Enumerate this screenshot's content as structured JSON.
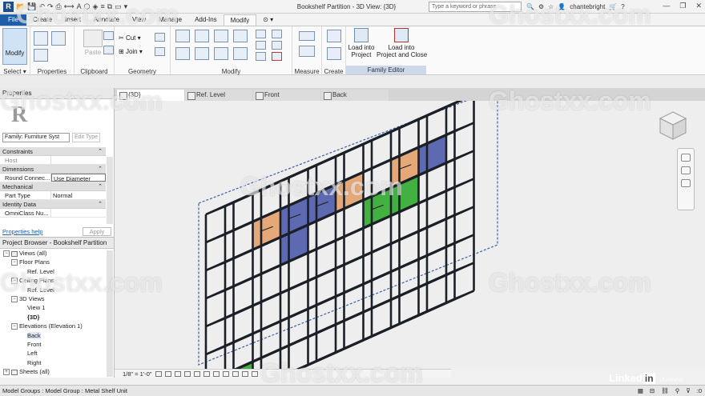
{
  "titlebar": {
    "title": "Bookshelf Partition - 3D View: {3D}",
    "search_placeholder": "Type a keyword or phrase",
    "user": "chantebright"
  },
  "menu": [
    "File",
    "Create",
    "Insert",
    "Annotate",
    "View",
    "Manage",
    "Add-Ins",
    "Modify"
  ],
  "active_menu": "Modify",
  "ribbon": {
    "select": {
      "modify": "Modify",
      "label": "Select ▾"
    },
    "properties_label": "Properties",
    "clipboard": {
      "paste": "Paste",
      "label": "Clipboard"
    },
    "geometry": {
      "cut": "Cut",
      "join": "Join",
      "label": "Geometry"
    },
    "modify_label": "Modify",
    "measure_label": "Measure",
    "create_label": "Create",
    "load_into_project": "Load into\nProject",
    "load_into_project_close": "Load into\nProject and Close",
    "family_editor_label": "Family Editor"
  },
  "view_tabs": [
    "{3D}",
    "Ref. Level",
    "Front",
    "Back"
  ],
  "properties": {
    "header": "Properties",
    "family": "Family: Furniture Syst",
    "edit_type": "Edit Type",
    "rows": [
      {
        "group": "Constraints"
      },
      {
        "key": "Host",
        "value": "",
        "dim": true
      },
      {
        "group": "Dimensions"
      },
      {
        "key": "Round Connec...",
        "value": "Use Diameter",
        "box": true
      },
      {
        "group": "Mechanical"
      },
      {
        "key": "Part Type",
        "value": "Normal"
      },
      {
        "group": "Identity Data"
      },
      {
        "key": "OmniClass Nu...",
        "value": ""
      }
    ],
    "help": "Properties help",
    "apply": "Apply"
  },
  "browser": {
    "header": "Project Browser - Bookshelf Partition",
    "nodes": [
      {
        "text": "Views (all)",
        "indent": 0,
        "toggle": "−",
        "icon": true
      },
      {
        "text": "Floor Plans",
        "indent": 1,
        "toggle": "−"
      },
      {
        "text": "Ref. Level",
        "indent": 3
      },
      {
        "text": "Ceiling Plans",
        "indent": 1,
        "toggle": "−"
      },
      {
        "text": "Ref. Level",
        "indent": 3
      },
      {
        "text": "3D Views",
        "indent": 1,
        "toggle": "−"
      },
      {
        "text": "View 1",
        "indent": 3
      },
      {
        "text": "{3D}",
        "indent": 3,
        "bold": true
      },
      {
        "text": "Elevations (Elevation 1)",
        "indent": 1,
        "toggle": "−"
      },
      {
        "text": "Back",
        "indent": 3,
        "highlight": true
      },
      {
        "text": "Front",
        "indent": 3
      },
      {
        "text": "Left",
        "indent": 3
      },
      {
        "text": "Right",
        "indent": 3
      },
      {
        "text": "Sheets (all)",
        "indent": 0,
        "toggle": "+",
        "icon": true
      },
      {
        "text": "Families",
        "indent": 0,
        "toggle": "+",
        "icon": true
      }
    ]
  },
  "view_control": {
    "scale": "1/8\" = 1'-0\""
  },
  "status": {
    "text": "Model Groups : Model Group : Metal Shelf Unit",
    "zoom": ":0"
  },
  "watermark": "Ghostxx.com",
  "linkedin": {
    "text": "Linked",
    "in": "in",
    "learning": "LEARNING"
  },
  "colors": {
    "file_tab": "#1f5fa8",
    "frame": "#1b1f26",
    "orange": "#e3a06c",
    "blue": "#4c5aa8",
    "green": "#2faa2f",
    "workplane": "#3a5fb0"
  }
}
